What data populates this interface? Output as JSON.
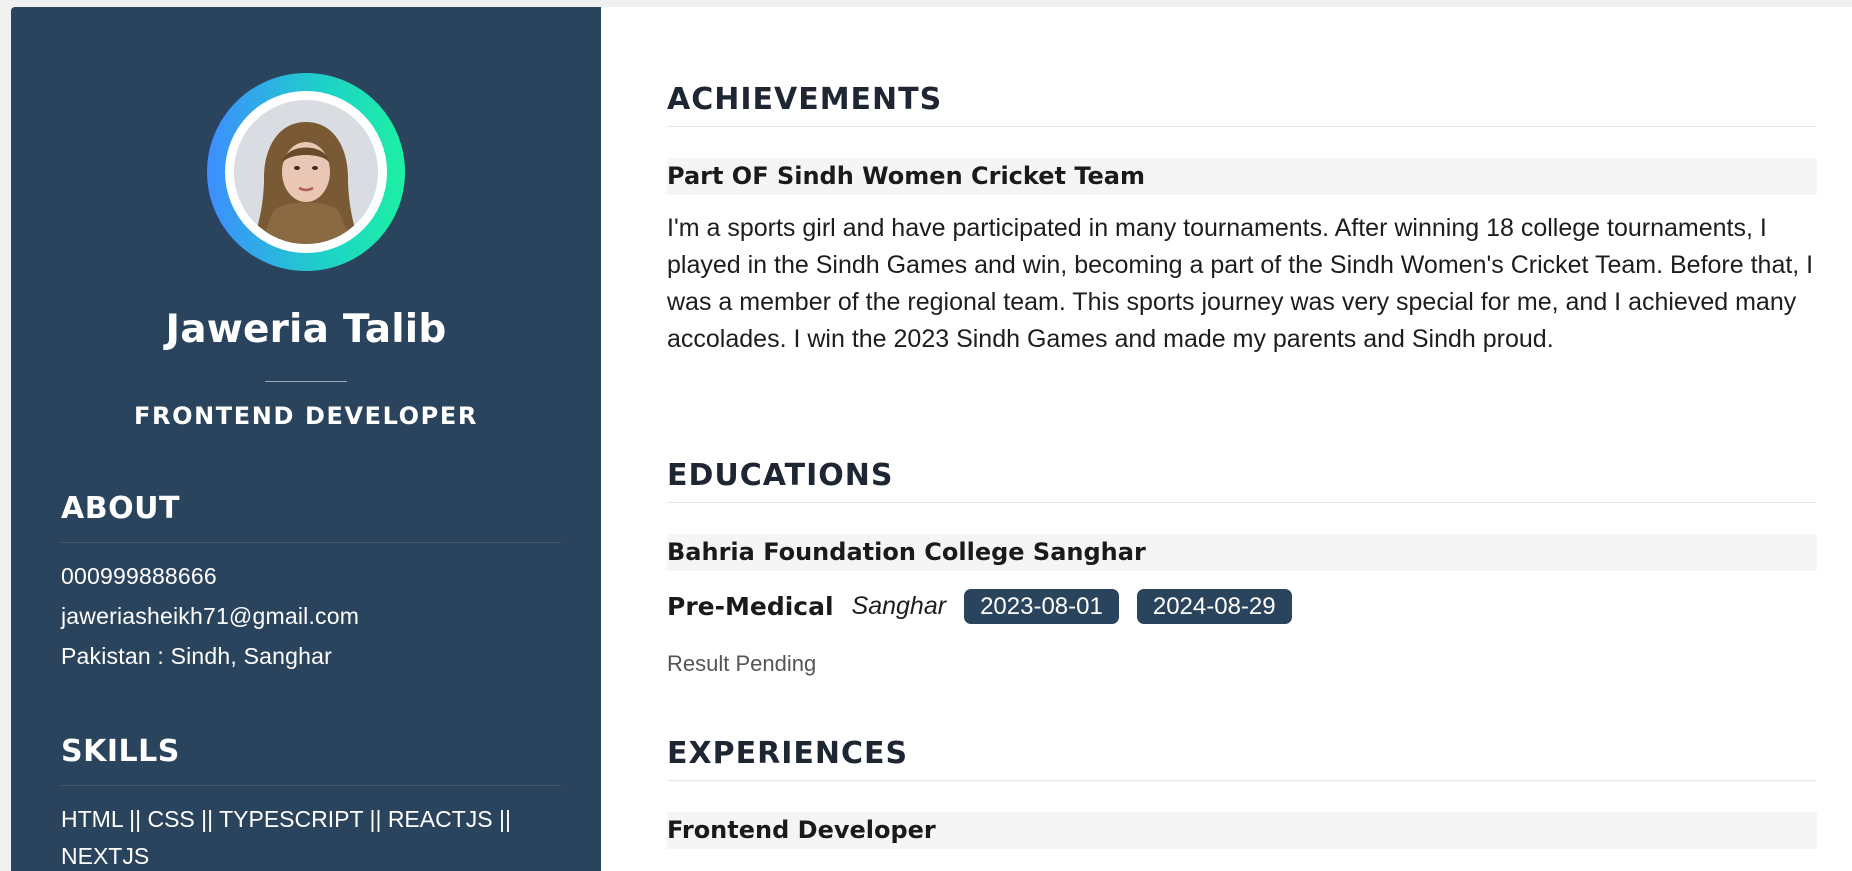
{
  "profile": {
    "name": "Jaweria Talib",
    "role": "FRONTEND DEVELOPER"
  },
  "about": {
    "heading": "ABOUT",
    "phone": "000999888666",
    "email": "jaweriasheikh71@gmail.com",
    "location": "Pakistan : Sindh, Sanghar"
  },
  "skills": {
    "heading": "SKILLS",
    "list": "HTML || CSS || TYPESCRIPT || REACTJS || NEXTJS"
  },
  "achievements": {
    "heading": "ACHIEVEMENTS",
    "title": "Part OF Sindh Women Cricket Team",
    "description": "I'm a sports girl and have participated in many tournaments. After winning 18 college tournaments, I played in the Sindh Games and win, becoming a part of the Sindh Women's Cricket Team. Before that, I was a member of the regional team. This sports journey was very special for me, and I achieved many accolades. I win the 2023 Sindh Games and made my parents and Sindh proud."
  },
  "educations": {
    "heading": "EDUCATIONS",
    "school": "Bahria Foundation College Sanghar",
    "degree": "Pre-Medical",
    "location": "Sanghar",
    "start_date": "2023-08-01",
    "end_date": "2024-08-29",
    "result": "Result Pending"
  },
  "experiences": {
    "heading": "EXPERIENCES",
    "title": "Frontend Developer"
  },
  "colors": {
    "sidebar": "#2b445d",
    "badge": "#2b445d",
    "ring_start": "#3d8dff",
    "ring_end": "#1df0a2"
  }
}
